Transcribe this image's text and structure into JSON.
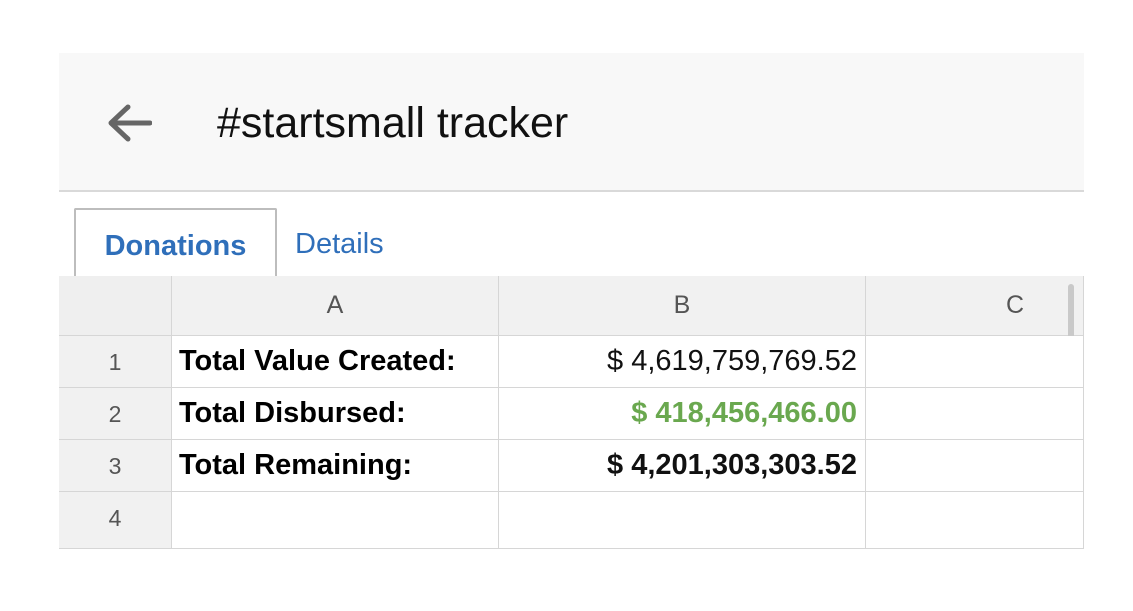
{
  "header": {
    "back_icon": "arrow-left-icon",
    "title": "#startsmall tracker"
  },
  "tabs": [
    {
      "label": "Donations",
      "active": true
    },
    {
      "label": "Details",
      "active": false
    }
  ],
  "sheet": {
    "columns": [
      "A",
      "B",
      "C"
    ],
    "rows": [
      {
        "num": "1",
        "a": "Total Value Created:",
        "b": "$ 4,619,759,769.52",
        "c": ""
      },
      {
        "num": "2",
        "a": "Total Disbursed:",
        "b": "$ 418,456,466.00",
        "c": ""
      },
      {
        "num": "3",
        "a": "Total Remaining:",
        "b": "$ 4,201,303,303.52",
        "c": ""
      },
      {
        "num": "4",
        "a": "",
        "b": "",
        "c": ""
      }
    ]
  },
  "colors": {
    "accent": "#2f6fba",
    "disbursed": "#6aa84f"
  }
}
